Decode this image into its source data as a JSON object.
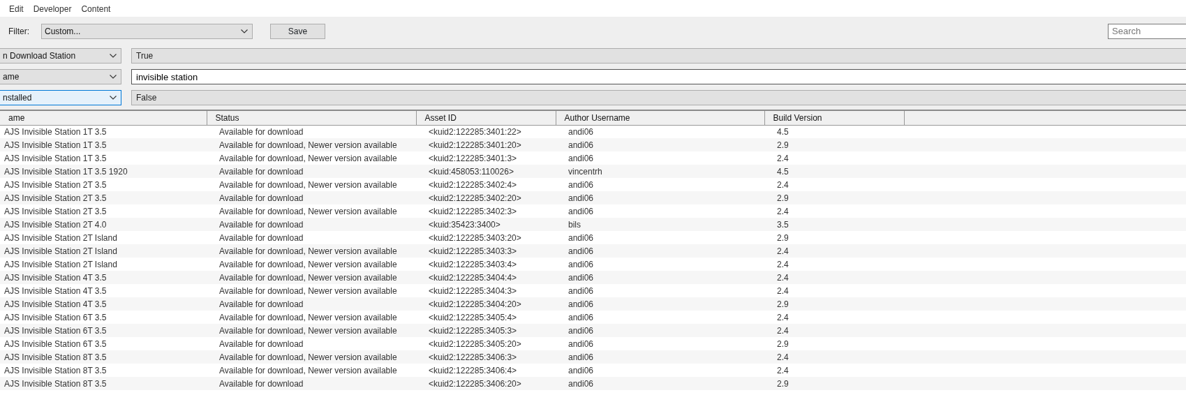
{
  "menu": [
    "Edit",
    "Developer",
    "Content"
  ],
  "toolbar": {
    "filter_label": "Filter:",
    "filter_value": "Custom...",
    "save_button": "Save",
    "search": {
      "placeholder": "Search"
    }
  },
  "conditions": [
    {
      "field": "n Download Station",
      "field_focused": false,
      "kind": "readonly",
      "value": "True"
    },
    {
      "field": "ame",
      "field_focused": false,
      "kind": "input",
      "value": "invisible station"
    },
    {
      "field": "nstalled",
      "field_focused": true,
      "kind": "readonly",
      "value": "False"
    }
  ],
  "table": {
    "columns": [
      "ame",
      "Status",
      "Asset ID",
      "Author Username",
      "Build Version"
    ],
    "rows": [
      [
        "AJS Invisible Station 1T 3.5",
        "Available for download",
        "<kuid2:122285:3401:22>",
        "andi06",
        "4.5"
      ],
      [
        "AJS Invisible Station 1T 3.5",
        "Available for download, Newer version available",
        "<kuid2:122285:3401:20>",
        "andi06",
        "2.9"
      ],
      [
        "AJS Invisible Station 1T 3.5",
        "Available for download, Newer version available",
        "<kuid2:122285:3401:3>",
        "andi06",
        "2.4"
      ],
      [
        "AJS Invisible Station 1T 3.5 1920",
        "Available for download",
        "<kuid:458053:110026>",
        "vincentrh",
        "4.5"
      ],
      [
        "AJS Invisible Station 2T 3.5",
        "Available for download, Newer version available",
        "<kuid2:122285:3402:4>",
        "andi06",
        "2.4"
      ],
      [
        "AJS Invisible Station 2T 3.5",
        "Available for download",
        "<kuid2:122285:3402:20>",
        "andi06",
        "2.9"
      ],
      [
        "AJS Invisible Station 2T 3.5",
        "Available for download, Newer version available",
        "<kuid2:122285:3402:3>",
        "andi06",
        "2.4"
      ],
      [
        "AJS Invisible Station 2T 4.0",
        "Available for download",
        "<kuid:35423:3400>",
        "bils",
        "3.5"
      ],
      [
        "AJS Invisible Station 2T Island",
        "Available for download",
        "<kuid2:122285:3403:20>",
        "andi06",
        "2.9"
      ],
      [
        "AJS Invisible Station 2T Island",
        "Available for download, Newer version available",
        "<kuid2:122285:3403:3>",
        "andi06",
        "2.4"
      ],
      [
        "AJS Invisible Station 2T Island",
        "Available for download, Newer version available",
        "<kuid2:122285:3403:4>",
        "andi06",
        "2.4"
      ],
      [
        "AJS Invisible Station 4T 3.5",
        "Available for download, Newer version available",
        "<kuid2:122285:3404:4>",
        "andi06",
        "2.4"
      ],
      [
        "AJS Invisible Station 4T 3.5",
        "Available for download, Newer version available",
        "<kuid2:122285:3404:3>",
        "andi06",
        "2.4"
      ],
      [
        "AJS Invisible Station 4T 3.5",
        "Available for download",
        "<kuid2:122285:3404:20>",
        "andi06",
        "2.9"
      ],
      [
        "AJS Invisible Station 6T 3.5",
        "Available for download, Newer version available",
        "<kuid2:122285:3405:4>",
        "andi06",
        "2.4"
      ],
      [
        "AJS Invisible Station 6T 3.5",
        "Available for download, Newer version available",
        "<kuid2:122285:3405:3>",
        "andi06",
        "2.4"
      ],
      [
        "AJS Invisible Station 6T 3.5",
        "Available for download",
        "<kuid2:122285:3405:20>",
        "andi06",
        "2.9"
      ],
      [
        "AJS Invisible Station 8T 3.5",
        "Available for download, Newer version available",
        "<kuid2:122285:3406:3>",
        "andi06",
        "2.4"
      ],
      [
        "AJS Invisible Station 8T 3.5",
        "Available for download, Newer version available",
        "<kuid2:122285:3406:4>",
        "andi06",
        "2.4"
      ],
      [
        "AJS Invisible Station 8T 3.5",
        "Available for download",
        "<kuid2:122285:3406:20>",
        "andi06",
        "2.9"
      ]
    ]
  }
}
